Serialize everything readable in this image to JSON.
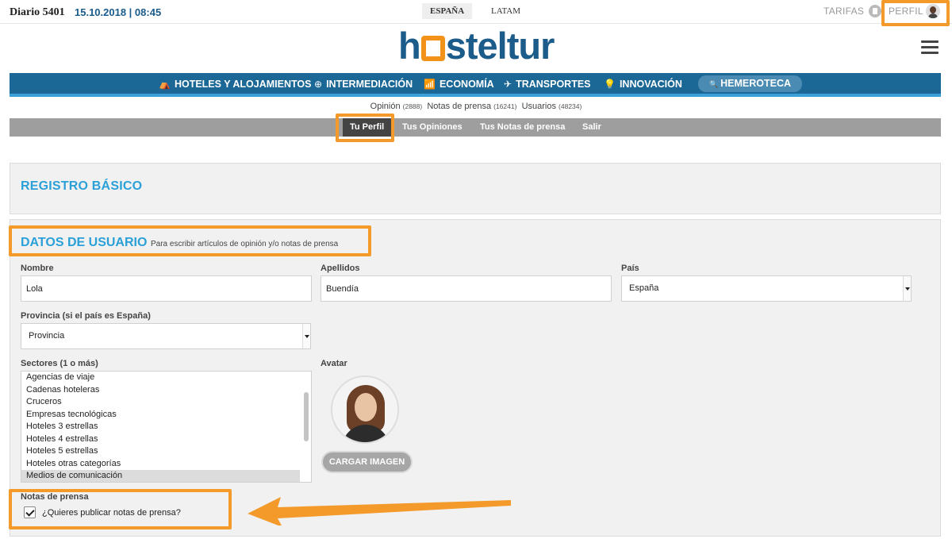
{
  "topbar": {
    "diario": "Diario 5401",
    "fecha": "15.10.2018 | 08:45",
    "editions": [
      "ESPAÑA",
      "LATAM"
    ],
    "tarifas": "TARIFAS",
    "perfil": "PERFIL"
  },
  "logo": {
    "pre": "h",
    "post": "steltur"
  },
  "mainnav": {
    "items": [
      {
        "icon": "⛺",
        "label": "HOTELES Y ALOJAMIENTOS"
      },
      {
        "icon": "⊕",
        "label": "INTERMEDIACIÓN"
      },
      {
        "icon": "📶",
        "label": "ECONOMÍA"
      },
      {
        "icon": "✈",
        "label": "TRANSPORTES"
      },
      {
        "icon": "💡",
        "label": "INNOVACIÓN"
      }
    ],
    "search_icon": "🔍",
    "hemeroteca": "HEMEROTECA"
  },
  "stats": {
    "opinion": "Opinión",
    "opinion_count": "(2888)",
    "notas": "Notas de prensa",
    "notas_count": "(16241)",
    "usuarios": "Usuarios",
    "usuarios_count": "(48234)"
  },
  "subnav": {
    "items": [
      "Tu Perfil",
      "Tus Opiniones",
      "Tus Notas de prensa",
      "Salir"
    ],
    "active": "Tu Perfil"
  },
  "registro": {
    "title": "REGISTRO BÁSICO"
  },
  "datos": {
    "title": "DATOS DE USUARIO",
    "subtitle": "Para escribir artículos de opinión y/o notas de prensa",
    "nombre_label": "Nombre",
    "nombre_value": "Lola",
    "apellidos_label": "Apellidos",
    "apellidos_value": "Buendía",
    "pais_label": "País",
    "pais_value": "España",
    "provincia_label": "Provincia (si el país es España)",
    "provincia_value": "Provincia",
    "sectores_label": "Sectores (1 o más)",
    "sectores": [
      "Agencias de viaje",
      "Cadenas hoteleras",
      "Cruceros",
      "Empresas tecnológicas",
      "Hoteles 3 estrellas",
      "Hoteles 4 estrellas",
      "Hoteles 5 estrellas",
      "Hoteles otras categorías",
      "Medios de comunicación"
    ],
    "sectores_selected": "Medios de comunicación",
    "avatar_label": "Avatar",
    "cargar_label": "CARGAR IMAGEN",
    "notas_label": "Notas de prensa",
    "notas_check_text": "¿Quieres publicar notas de prensa?",
    "notas_checked": true
  },
  "colors": {
    "brand_blue": "#1b6796",
    "accent_blue": "#2ba0d8",
    "logo_orange": "#f29219",
    "annotation_orange": "#f39a2a",
    "subnav_gray": "#9e9e9e"
  }
}
